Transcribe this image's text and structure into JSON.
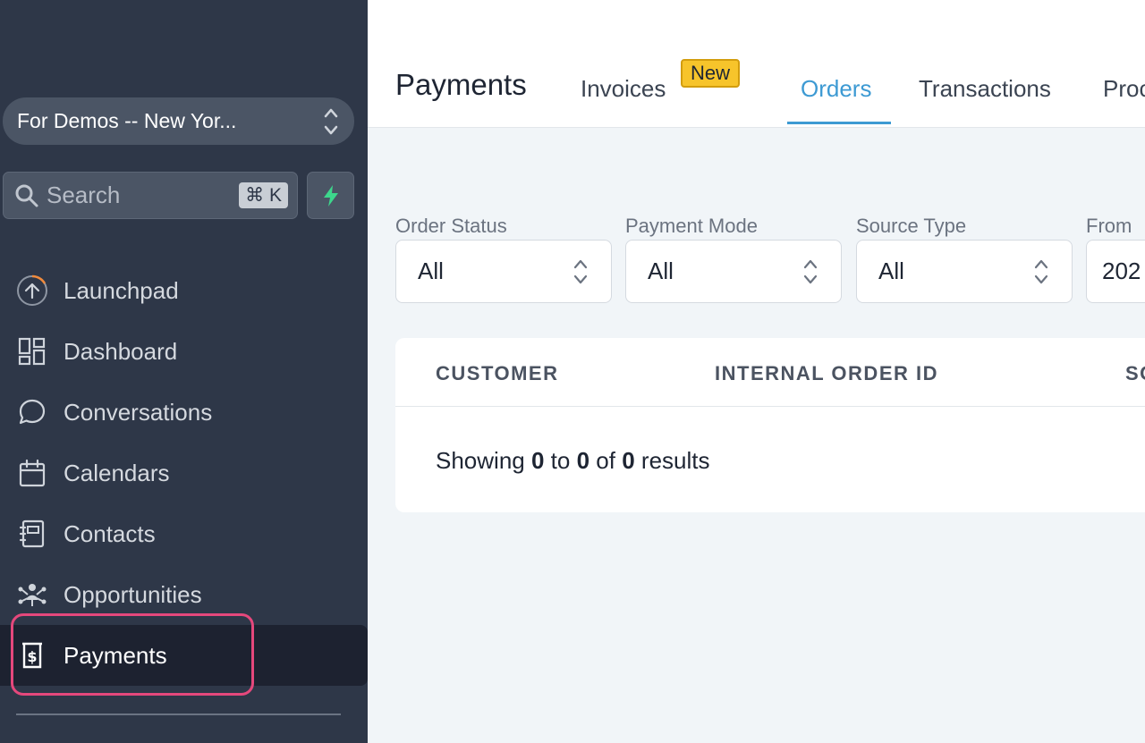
{
  "sidebar": {
    "account": "For Demos -- New Yor...",
    "search": {
      "placeholder": "Search",
      "shortcut": "⌘ K"
    },
    "items": [
      {
        "label": "Launchpad",
        "icon": "launchpad-icon"
      },
      {
        "label": "Dashboard",
        "icon": "dashboard-grid-icon"
      },
      {
        "label": "Conversations",
        "icon": "chat-bubble-icon"
      },
      {
        "label": "Calendars",
        "icon": "calendar-icon"
      },
      {
        "label": "Contacts",
        "icon": "contacts-book-icon"
      },
      {
        "label": "Opportunities",
        "icon": "opportunities-network-icon"
      },
      {
        "label": "Payments",
        "icon": "payments-receipt-icon",
        "active": true
      }
    ]
  },
  "header": {
    "title": "Payments",
    "tabs": [
      {
        "label": "Invoices"
      },
      {
        "label": "Orders",
        "active": true
      },
      {
        "label": "Transactions"
      },
      {
        "label": "Proc"
      }
    ],
    "new_badge": "New"
  },
  "filters": [
    {
      "label": "Order Status",
      "value": "All"
    },
    {
      "label": "Payment Mode",
      "value": "All"
    },
    {
      "label": "Source Type",
      "value": "All"
    },
    {
      "label": "From",
      "value": "202"
    }
  ],
  "table": {
    "columns": [
      "CUSTOMER",
      "INTERNAL ORDER ID",
      "SO"
    ],
    "results": {
      "prefix": "Showing",
      "from": "0",
      "to_word": "to",
      "to": "0",
      "of_word": "of",
      "total": "0",
      "suffix": "results"
    }
  },
  "colors": {
    "sidebar_bg": "#2e3748",
    "accent": "#3d9ad3",
    "highlight": "#e5487c",
    "badge": "#f7c42b",
    "bolt": "#3dd68c"
  }
}
